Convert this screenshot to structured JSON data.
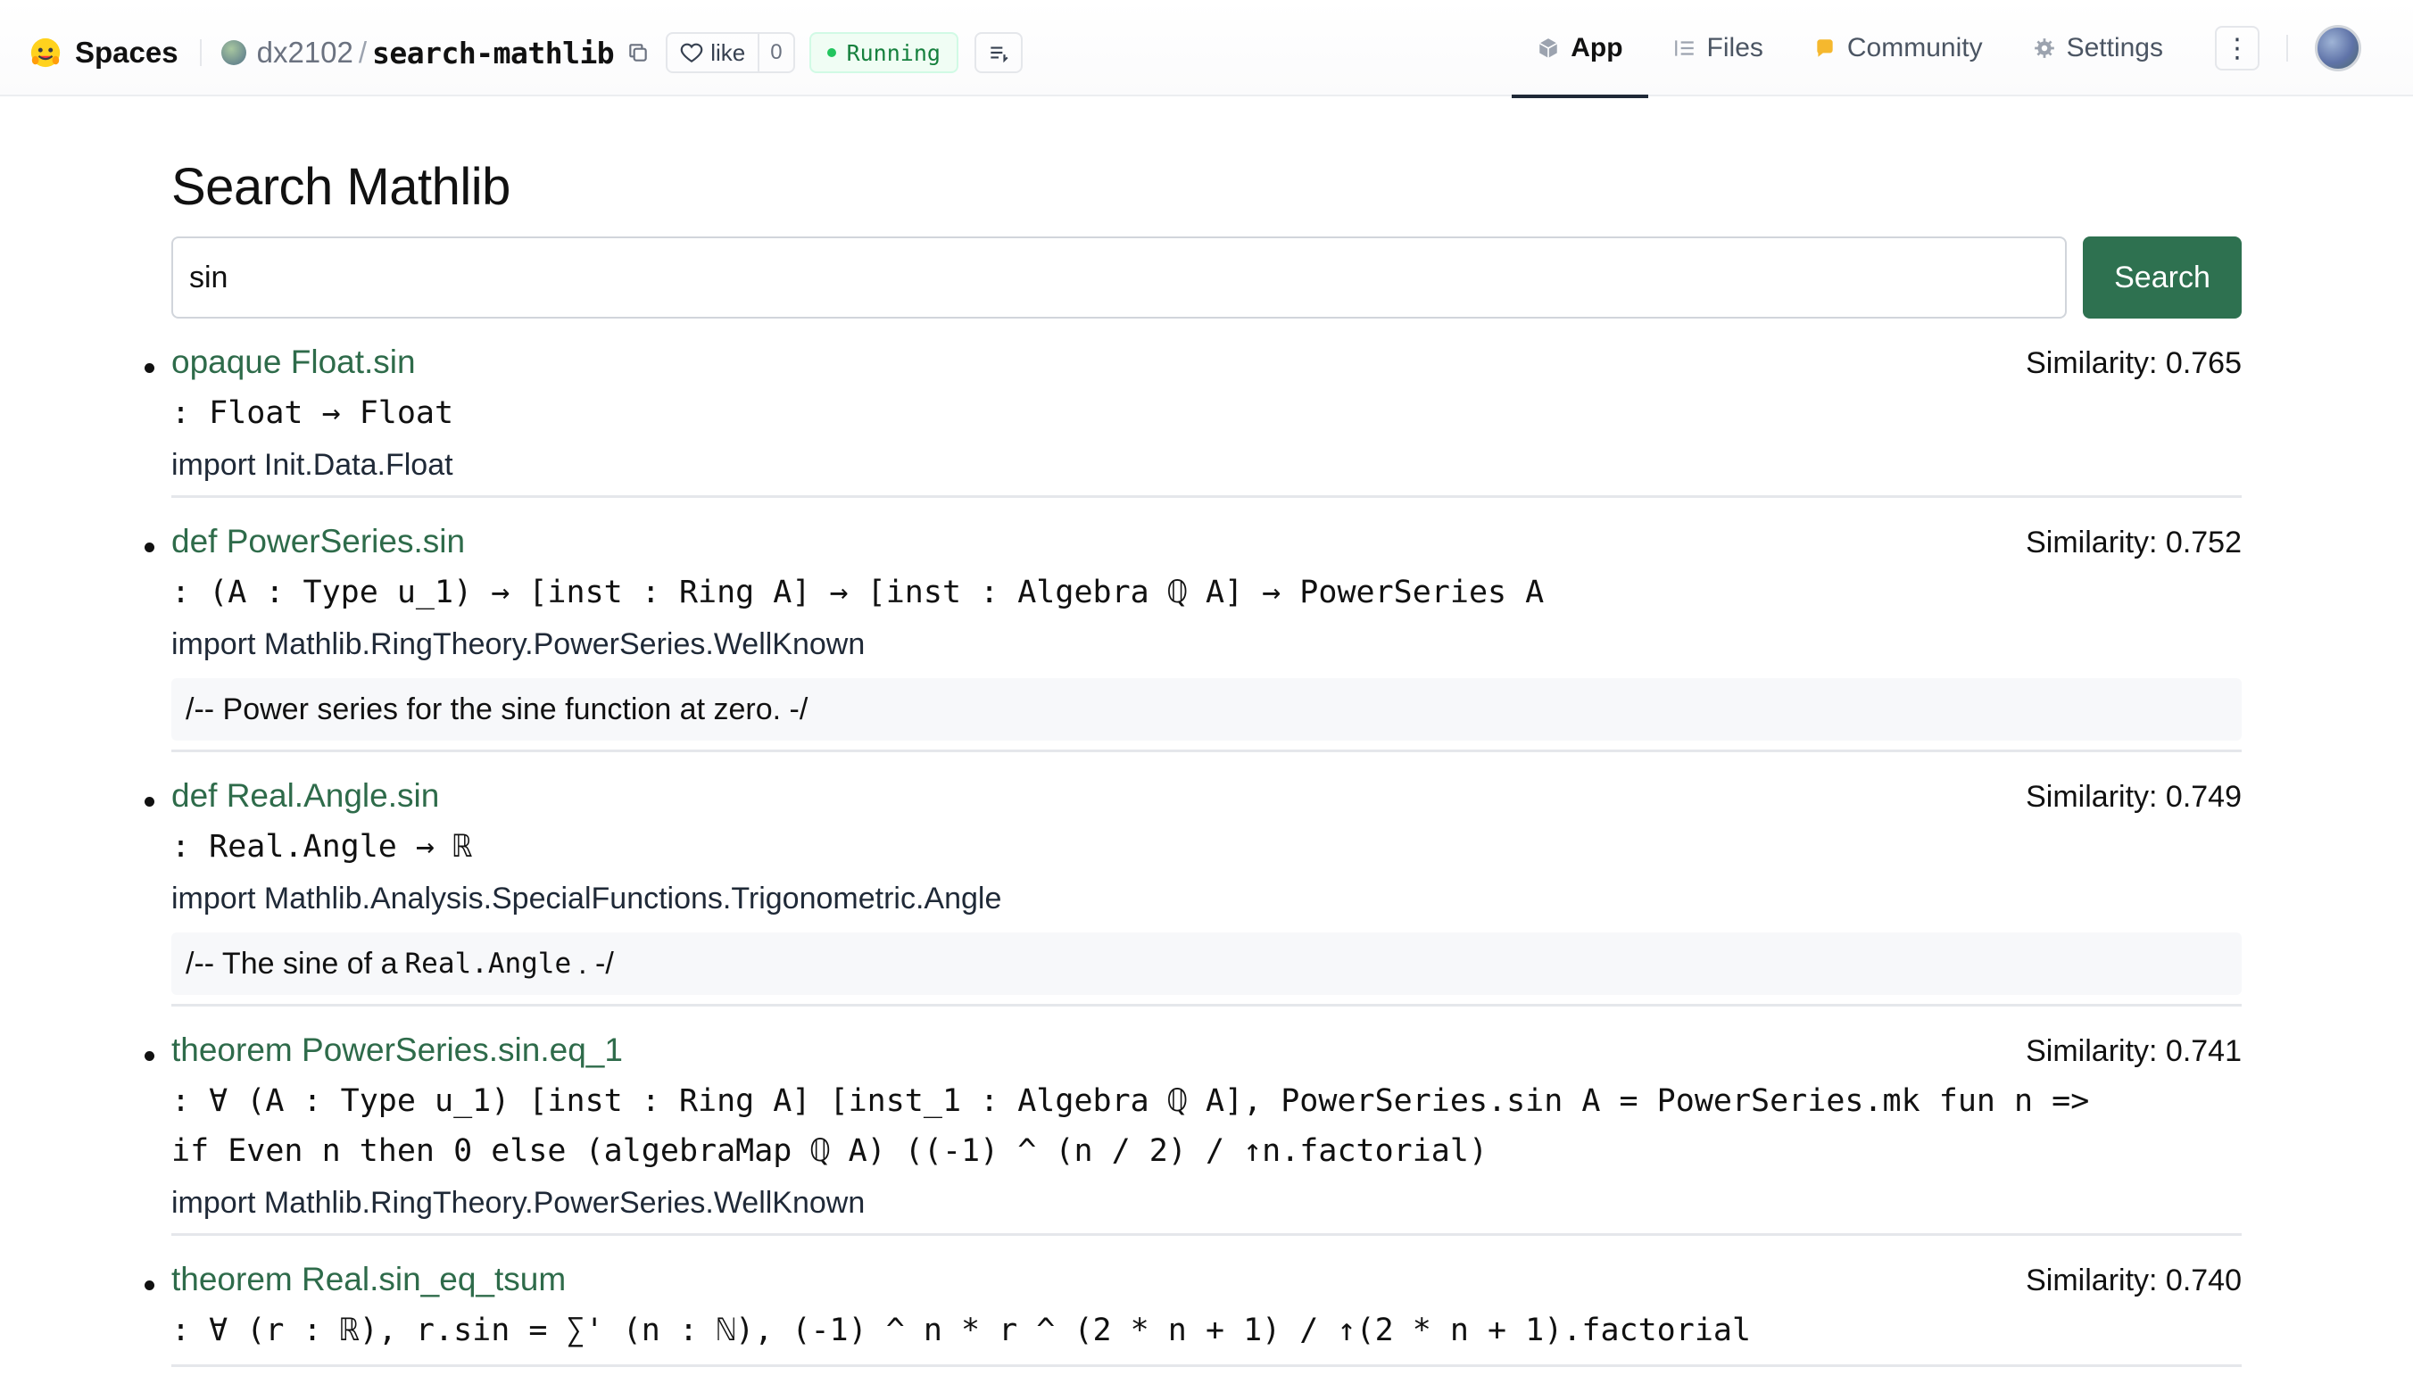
{
  "header": {
    "brand": "Spaces",
    "owner": "dx2102",
    "separator": "/",
    "repo": "search-mathlib",
    "like_label": "like",
    "like_count": "0",
    "status": "Running",
    "tabs": [
      {
        "label": "App",
        "icon": "cube-icon"
      },
      {
        "label": "Files",
        "icon": "files-icon"
      },
      {
        "label": "Community",
        "icon": "community-icon"
      },
      {
        "label": "Settings",
        "icon": "gear-icon"
      }
    ],
    "menu_glyph": "⋮"
  },
  "main": {
    "title": "Search Mathlib",
    "search_value": "sin",
    "search_button": "Search"
  },
  "results": [
    {
      "name": "opaque Float.sin",
      "similarity": "Similarity: 0.765",
      "type": ": Float → Float",
      "import": "import Init.Data.Float"
    },
    {
      "name": "def PowerSeries.sin",
      "similarity": "Similarity: 0.752",
      "type": ": (A : Type u_1) → [inst : Ring A] → [inst : Algebra ℚ A] → PowerSeries A",
      "import": "import Mathlib.RingTheory.PowerSeries.WellKnown",
      "doc": "/-- Power series for the sine function at zero. -/"
    },
    {
      "name": "def Real.Angle.sin",
      "similarity": "Similarity: 0.749",
      "type": ": Real.Angle → ℝ",
      "import": "import Mathlib.Analysis.SpecialFunctions.Trigonometric.Angle",
      "doc_prefix": "/-- The sine of a",
      "doc_code": "Real.Angle",
      "doc_suffix": ". -/"
    },
    {
      "name": "theorem PowerSeries.sin.eq_1",
      "similarity": "Similarity: 0.741",
      "type": ": ∀ (A : Type u_1) [inst : Ring A] [inst_1 : Algebra ℚ A], PowerSeries.sin A = PowerSeries.mk fun n =>\nif Even n then 0 else (algebraMap ℚ A) ((-1) ^ (n / 2) / ↑n.factorial)",
      "import": "import Mathlib.RingTheory.PowerSeries.WellKnown"
    },
    {
      "name": "theorem Real.sin_eq_tsum",
      "similarity": "Similarity: 0.740",
      "type": ": ∀ (r : ℝ), r.sin = ∑' (n : ℕ), (-1) ^ n * r ^ (2 * n + 1) / ↑(2 * n + 1).factorial"
    }
  ]
}
